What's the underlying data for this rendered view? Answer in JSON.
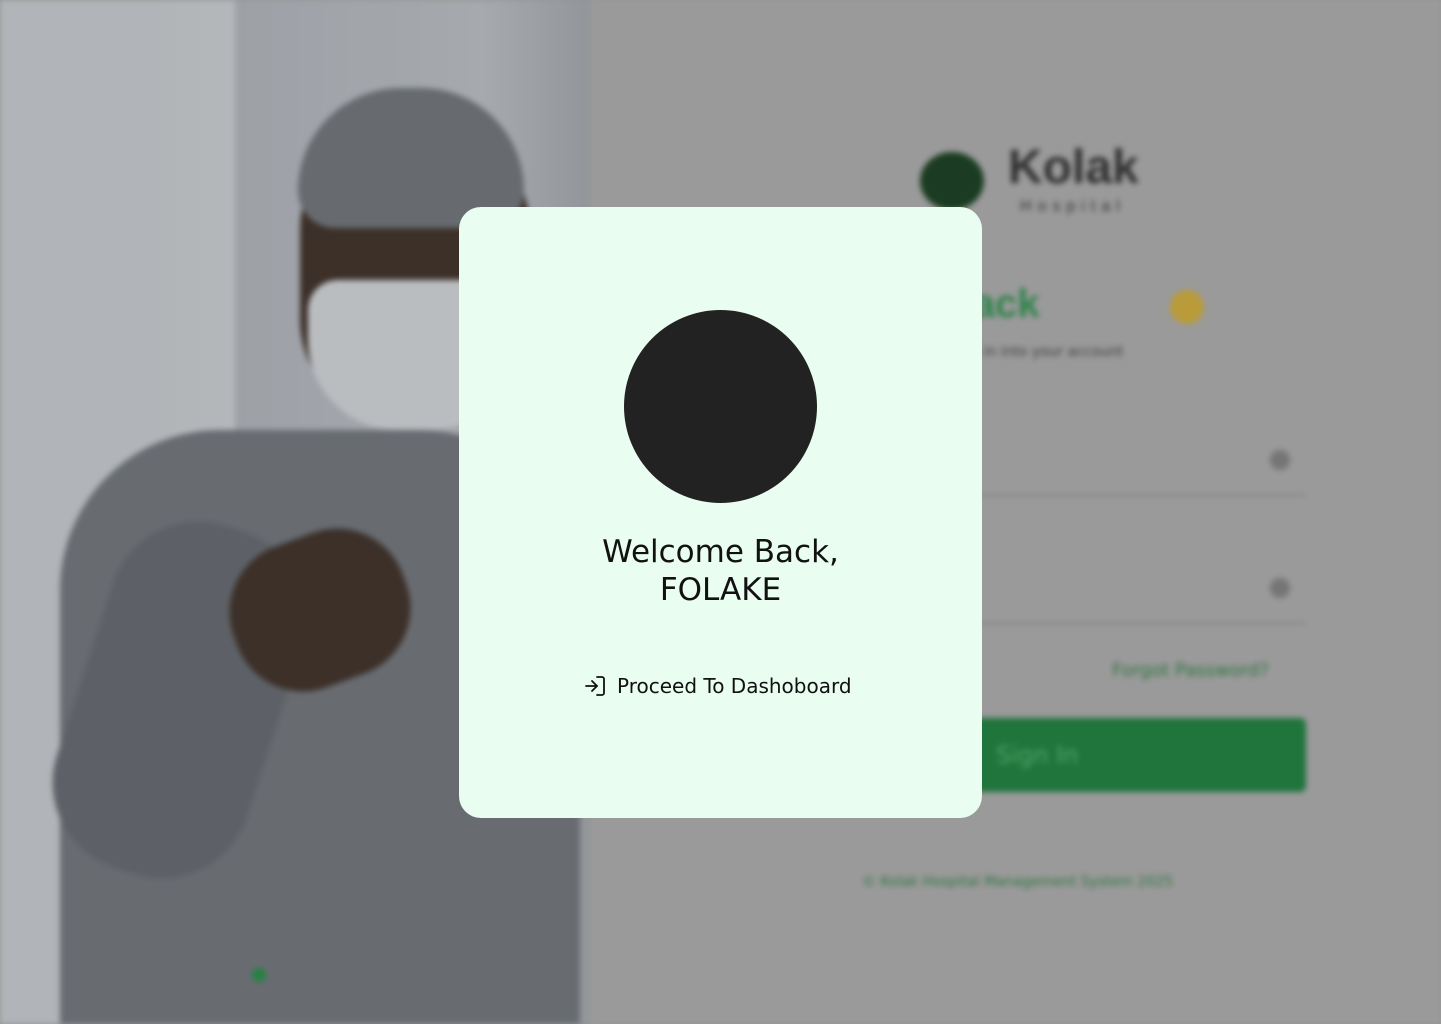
{
  "background": {
    "brand": {
      "name": "Kolak",
      "tagline": "Hospital"
    },
    "heading": "me Back",
    "subheading": "g in into your account",
    "forgot_password": "Forgot Password?",
    "sign_in_label": "Sign In",
    "copyright": "© Kolak Hospital Management System 2025"
  },
  "modal": {
    "greeting_line1": "Welcome Back,",
    "greeting_line2": "FOLAKE",
    "proceed_label": "Proceed To Dashoboard",
    "proceed_icon": "login-arrow-icon"
  },
  "colors": {
    "modal_bg": "#e9fdf1",
    "brand_green": "#1a7a3a",
    "avatar": "#222222"
  }
}
